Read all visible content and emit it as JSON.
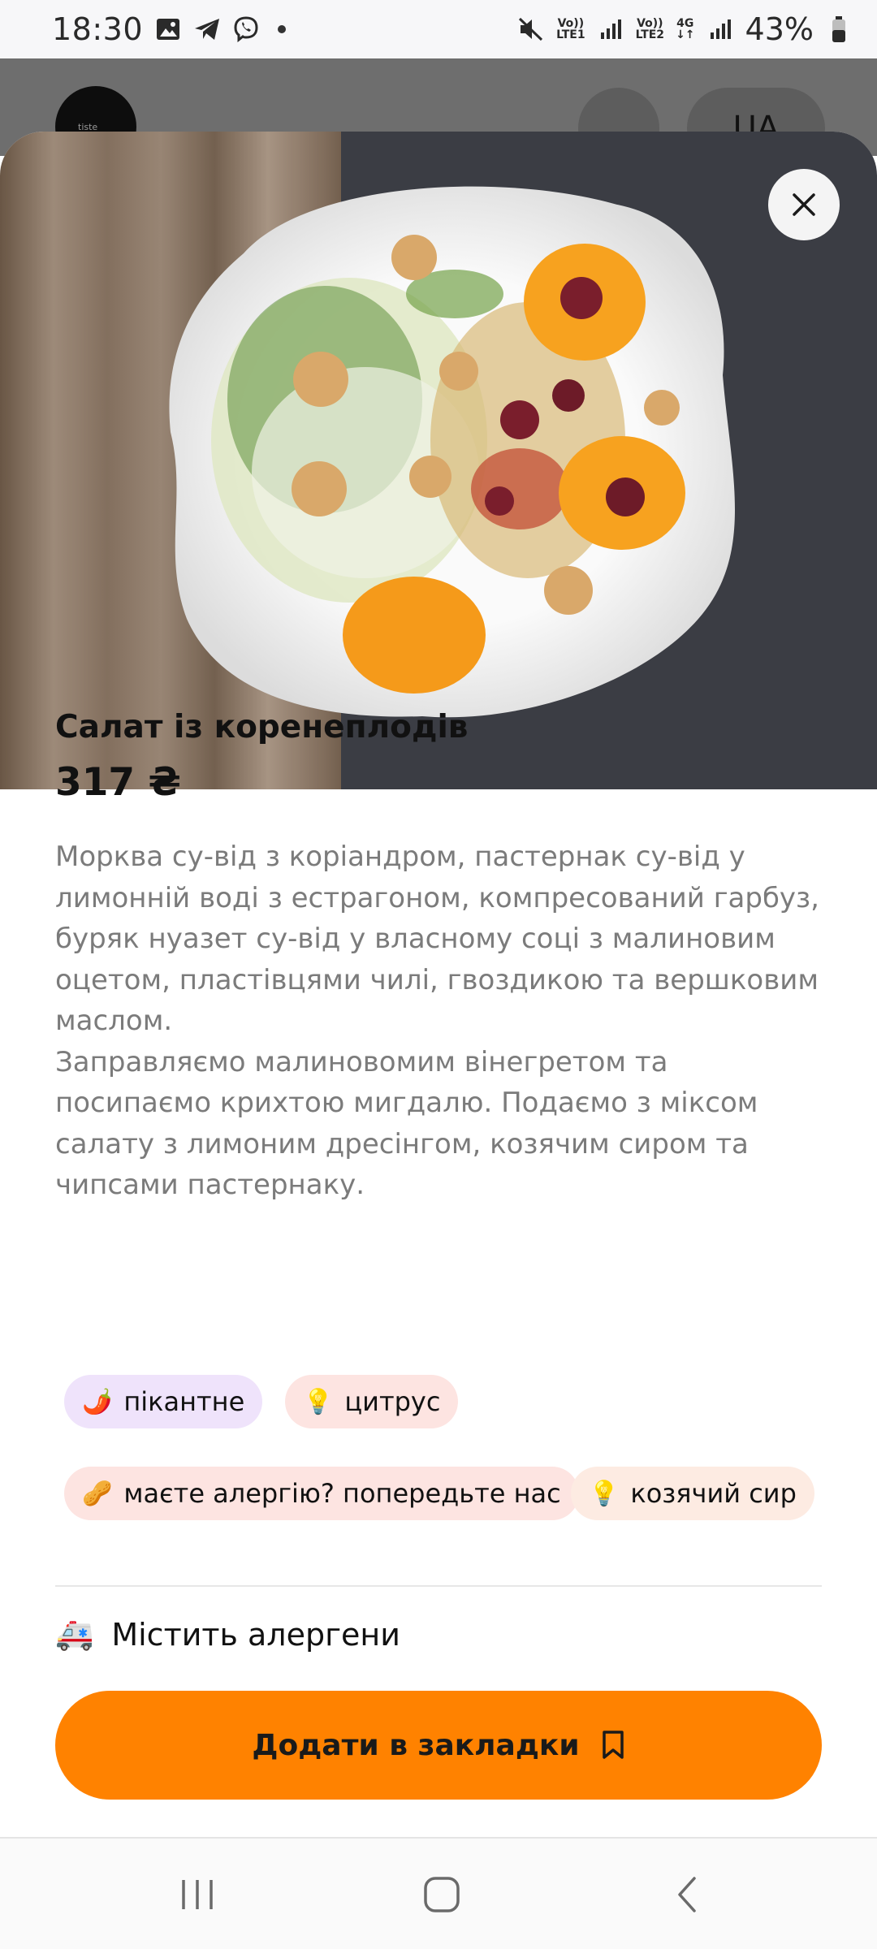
{
  "status_bar": {
    "time": "18:30",
    "network_1": "LTE1",
    "network_2": "LTE2",
    "network_type": "4G",
    "battery": "43%",
    "volte_label": "Vo))"
  },
  "background_header": {
    "logo_text": "tiste",
    "language": "UA"
  },
  "dish": {
    "title": "Салат із коренеплодів",
    "price": "317 ₴",
    "description_1": "Морква су-від з коріандром, пастернак су-від у лимонній воді з естрагоном, компресований гарбуз, буряк нуазет су-від у власному соці з малиновим оцетом, пластівцями чилі, гвоздикою та вершковим маслом.",
    "description_2": "Заправляємо малиновомим вінегретом та посипаємо крихтою мигдалю. Подаємо з міксом салату з лимоним дресінгом, козячим сиром та чипсами пастернаку."
  },
  "tags": [
    {
      "emoji": "🌶️",
      "label": "пікантне",
      "color": "#efe3fb"
    },
    {
      "emoji": "💡",
      "label": "цитрус",
      "color": "#fde4e1"
    },
    {
      "emoji": "🥜",
      "label": "маєте алергію? попередьте нас",
      "color": "#fde4e1"
    },
    {
      "emoji": "💡",
      "label": "козячий сир",
      "color": "#fdebe2"
    }
  ],
  "allergens": {
    "emoji": "🚑",
    "label": "Містить алергени"
  },
  "actions": {
    "bookmark_label": "Додати в закладки",
    "accent_color": "#ff8200"
  }
}
